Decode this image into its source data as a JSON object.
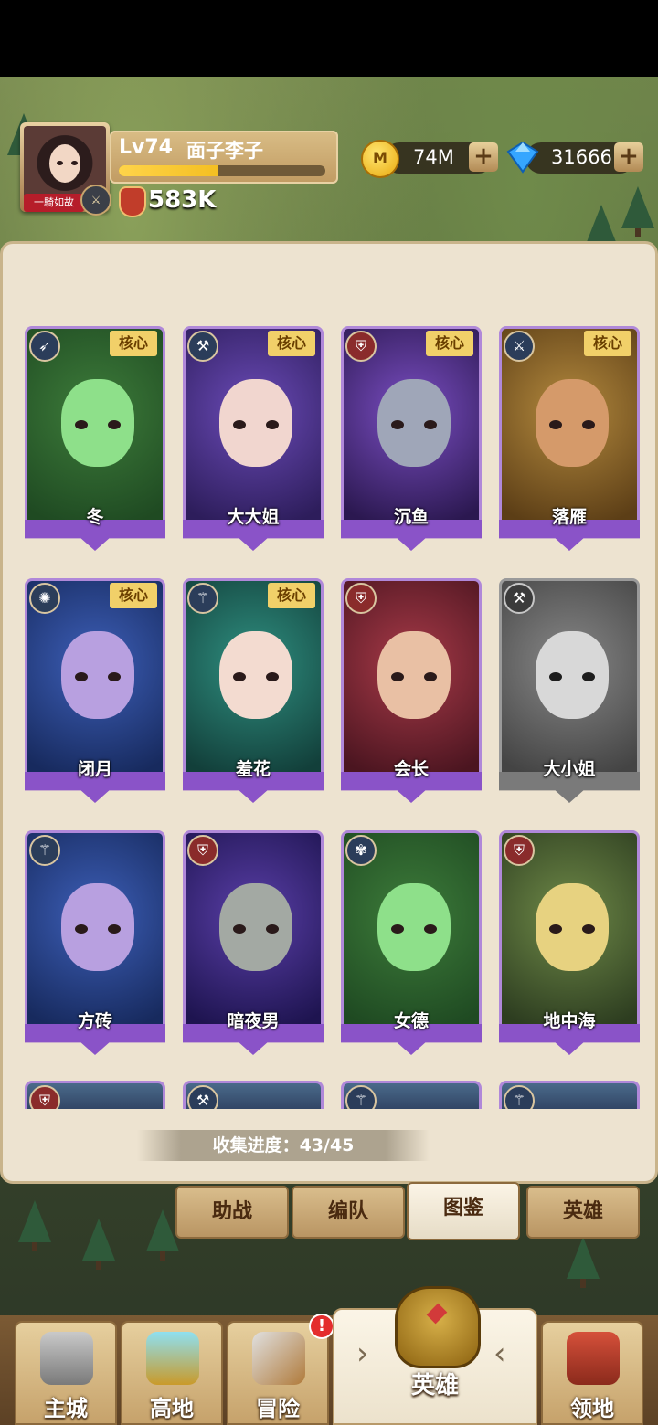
{
  "player": {
    "level": "Lv74",
    "name": "面子李子",
    "tag": "一騎如故",
    "power": "583K",
    "xp_fraction": 0.48
  },
  "resources": {
    "gold": "74M",
    "gems": "31666"
  },
  "heroes": [
    {
      "name": "冬",
      "core": "核心",
      "class": "archer-icon",
      "palette": "green"
    },
    {
      "name": "大大姐",
      "core": "核心",
      "class": "axe-icon",
      "palette": "purple"
    },
    {
      "name": "沉鱼",
      "core": "核心",
      "class": "shield-icon",
      "palette": "violet"
    },
    {
      "name": "落雁",
      "core": "核心",
      "class": "crossed-swords-icon",
      "palette": "gold"
    },
    {
      "name": "闭月",
      "core": "核心",
      "class": "holy-icon",
      "palette": "blue"
    },
    {
      "name": "羞花",
      "core": "核心",
      "class": "staff-icon",
      "palette": "teal"
    },
    {
      "name": "会长",
      "core": "",
      "class": "shield-icon",
      "palette": "red"
    },
    {
      "name": "大小姐",
      "core": "",
      "class": "axe-icon",
      "palette": "gray"
    },
    {
      "name": "方砖",
      "core": "",
      "class": "staff-icon",
      "palette": "blue"
    },
    {
      "name": "暗夜男",
      "core": "",
      "class": "shield-icon",
      "palette": "indigo"
    },
    {
      "name": "女德",
      "core": "",
      "class": "paw-icon",
      "palette": "green"
    },
    {
      "name": "地中海",
      "core": "",
      "class": "shield-icon",
      "palette": "olive"
    }
  ],
  "collection": {
    "label": "收集进度：43/45"
  },
  "subtabs": [
    "助战",
    "编队",
    "图鉴",
    "英雄"
  ],
  "active_subtab": "图鉴",
  "nav": {
    "main_city": "主城",
    "highland": "高地",
    "adventure": "冒险",
    "adventure_badge": "!",
    "heroes": "英雄",
    "territory": "领地"
  }
}
